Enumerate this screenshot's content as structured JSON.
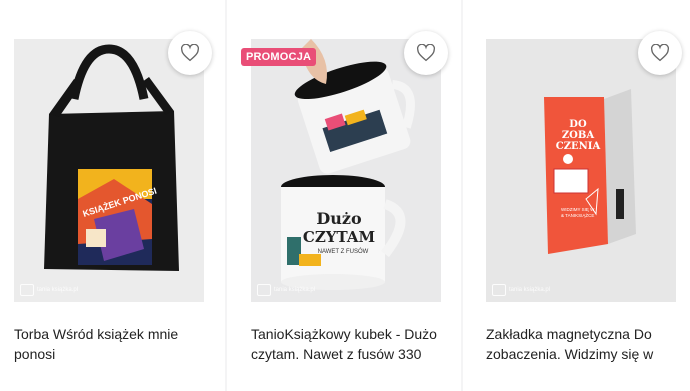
{
  "products": [
    {
      "title": "Torba Wśród książek mnie ponosi",
      "image": "tote-bag-image",
      "favorite_icon": "heart-outline-icon",
      "watermark": "tania książka.pl",
      "print_text": "KSIĄŻEK PONOSI"
    },
    {
      "title": "TanioKsiążkowy kubek - Dużo czytam. Nawet z fusów 330",
      "badge": "PROMOCJA",
      "badge_color": "#e94e77",
      "image": "mug-image",
      "favorite_icon": "heart-outline-icon",
      "watermark": "tania książka.pl",
      "mug_line1": "Dużo",
      "mug_line2": "CZYTAM",
      "mug_line3": "NAWET Z FUSÓW"
    },
    {
      "title": "Zakładka magnetyczna Do zobaczenia. Widzimy się w",
      "image": "bookmark-image",
      "favorite_icon": "heart-outline-icon",
      "watermark": "tania książka.pl",
      "bookmark_line1": "DO",
      "bookmark_line2": "ZOBA",
      "bookmark_line3": "CZENIA",
      "bookmark_small": "WIDZIMY SIĘ W",
      "bookmark_small2": "& TANIKSIĄŻCE",
      "accent": "#f0553b"
    }
  ]
}
